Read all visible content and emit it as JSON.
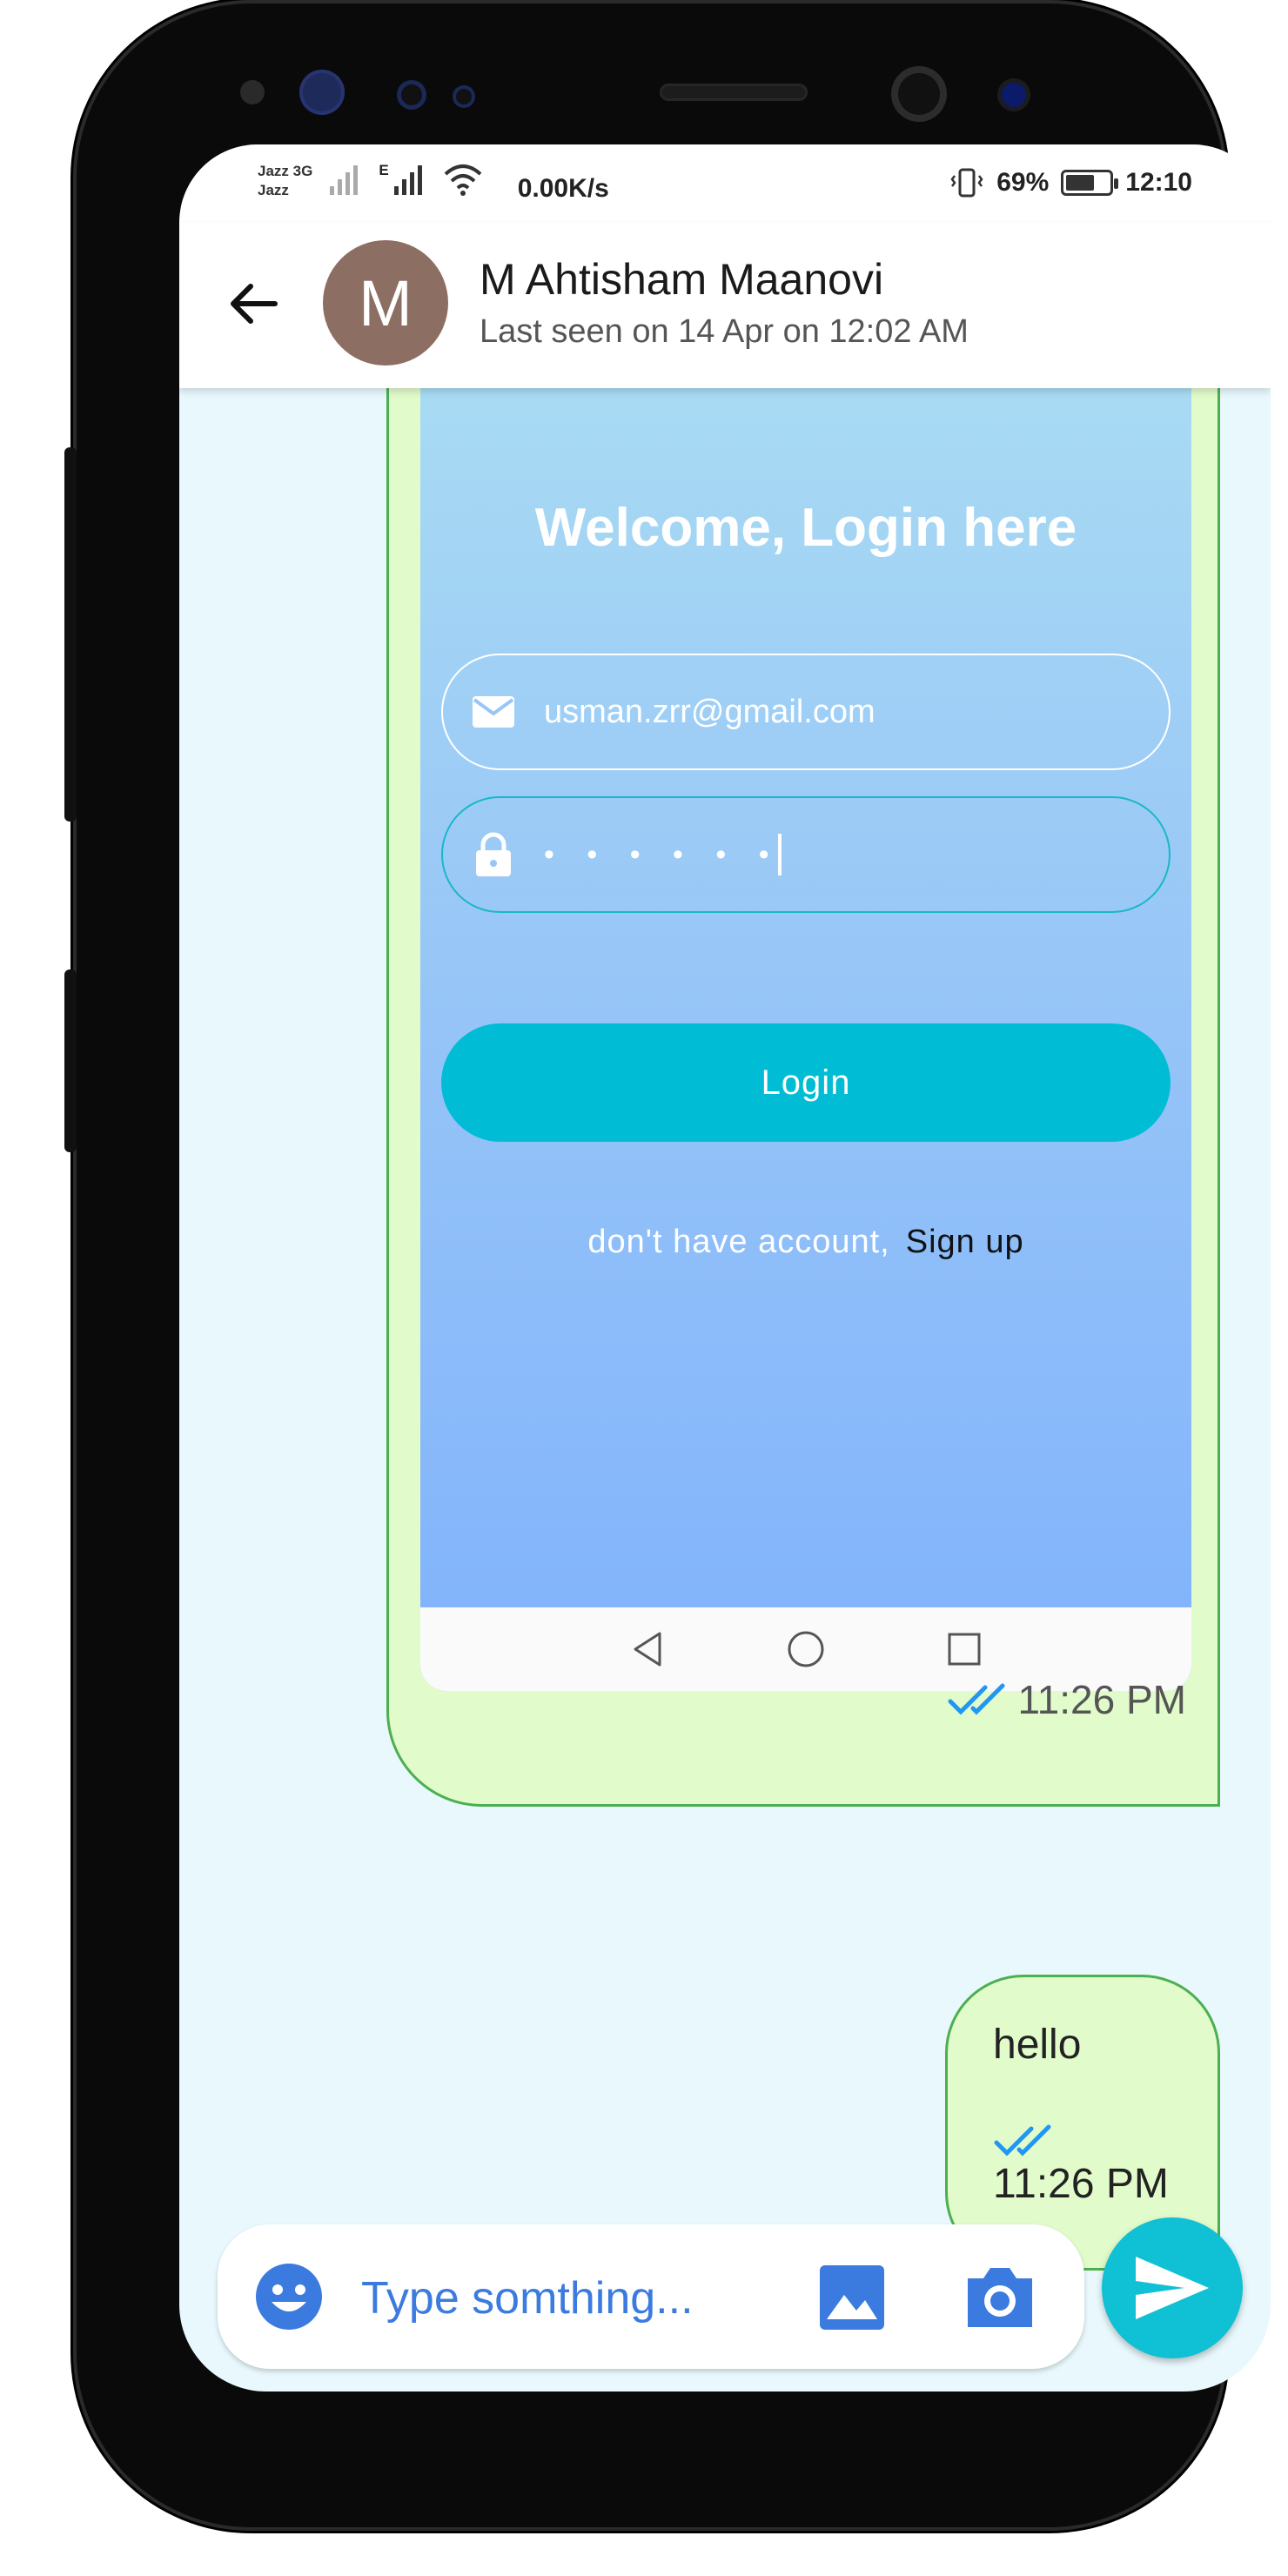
{
  "status_bar": {
    "carrier_1": "Jazz",
    "carrier_1_net": "3G",
    "carrier_2": "Jazz",
    "carrier_2_net": "E",
    "net_speed": "0.00K/s",
    "battery": "69%",
    "battery_level": 0.69,
    "time": "12:10"
  },
  "header": {
    "avatar_initial": "M",
    "avatar_color": "#8d6e63",
    "contact_name": "M Ahtisham Maanovi",
    "last_seen": "Last seen on 14 Apr on 12:02 AM"
  },
  "image_message": {
    "screenshot": {
      "title": "Welcome, Login here",
      "email": "usman.zrr@gmail.com",
      "password_mask": "• • • • • •",
      "login_label": "Login",
      "signup_prompt": "don't have account,",
      "signup_link": "Sign up"
    },
    "time": "11:26 PM"
  },
  "text_message": {
    "text": "hello",
    "time": "11:26 PM"
  },
  "composer": {
    "placeholder": "Type somthing..."
  },
  "colors": {
    "accent": "#10c0d4",
    "bubble_bg": "#e1fbcb",
    "bubble_border": "#4caf50",
    "chat_bg": "#e8f8fc",
    "tick_blue": "#2196f3",
    "icon_blue": "#3b7be0"
  }
}
